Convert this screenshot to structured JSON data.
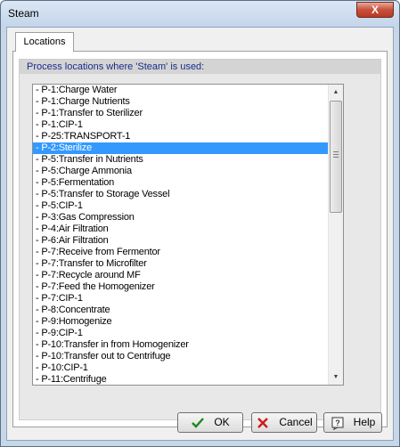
{
  "window": {
    "title": "Steam",
    "close_label": "X"
  },
  "tabs": [
    {
      "label": "Locations",
      "active": true
    }
  ],
  "group": {
    "header": "Process locations where 'Steam' is used:"
  },
  "list": {
    "items": [
      "- P-1:Charge Water",
      "- P-1:Charge Nutrients",
      "- P-1:Transfer to Sterilizer",
      "- P-1:CIP-1",
      "- P-25:TRANSPORT-1",
      "- P-2:Sterilize",
      "- P-5:Transfer in Nutrients",
      "- P-5:Charge Ammonia",
      "- P-5:Fermentation",
      "- P-5:Transfer to Storage Vessel",
      "- P-5:CIP-1",
      "- P-3:Gas Compression",
      "- P-4:Air Filtration",
      "- P-6:Air Filtration",
      "- P-7:Receive from Fermentor",
      "- P-7:Transfer to Microfilter",
      "- P-7:Recycle around MF",
      "- P-7:Feed the Homogenizer",
      "- P-7:CIP-1",
      "- P-8:Concentrate",
      "- P-9:Homogenize",
      "- P-9:CIP-1",
      "- P-10:Transfer in from Homogenizer",
      "- P-10:Transfer out to Centrifuge",
      "- P-10:CIP-1",
      "- P-11:Centrifuge"
    ],
    "selected_index": 5,
    "selected_color": "#3399ff"
  },
  "buttons": {
    "ok": {
      "label": "OK",
      "icon": "checkmark-icon",
      "color": "#1a8a1a"
    },
    "cancel": {
      "label": "Cancel",
      "icon": "x-icon",
      "color": "#d01a1a"
    },
    "help": {
      "label": "Help",
      "icon": "help-icon"
    }
  }
}
